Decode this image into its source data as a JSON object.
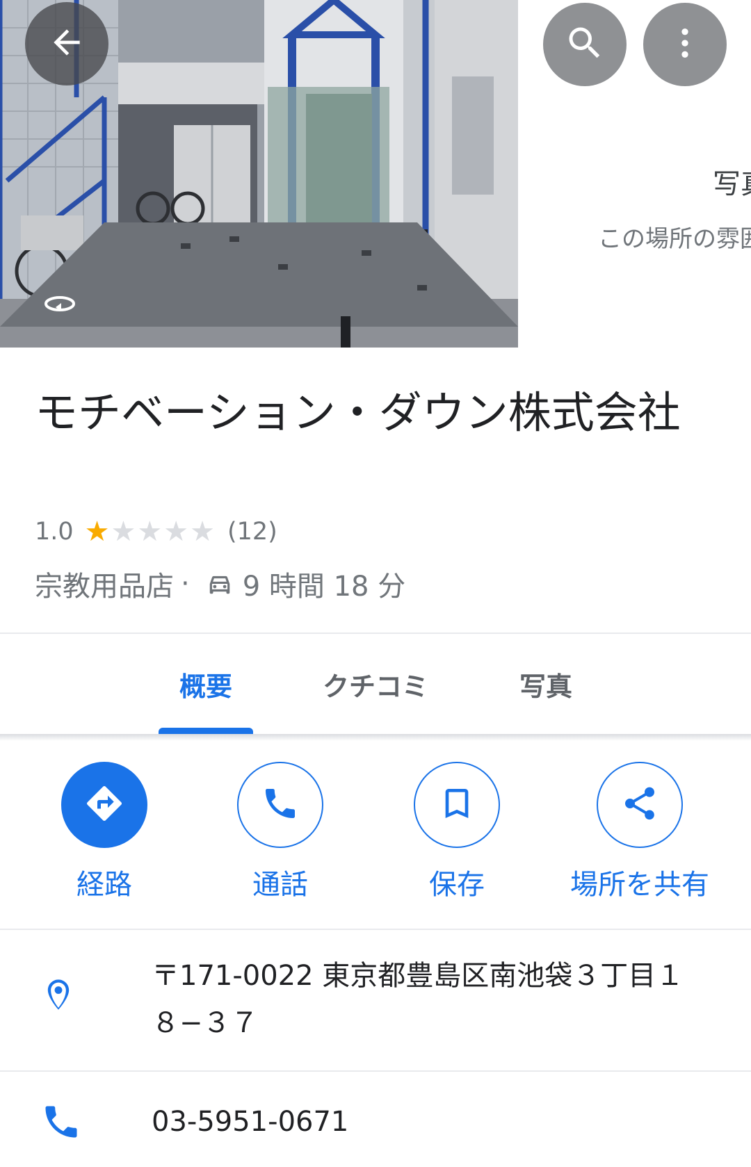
{
  "header": {
    "side_panel_title": "写真",
    "side_panel_subtitle": "この場所の雰囲"
  },
  "place": {
    "name": "モチベーション・ダウン株式会社",
    "rating": "1.0",
    "rating_value": 1.0,
    "rating_max": 5,
    "review_count": "(12)",
    "category": "宗教用品店",
    "separator": "·",
    "drive_time": "9 時間 18 分"
  },
  "tabs": [
    {
      "label": "概要",
      "active": true
    },
    {
      "label": "クチコミ",
      "active": false
    },
    {
      "label": "写真",
      "active": false
    }
  ],
  "actions": [
    {
      "label": "経路",
      "icon": "directions-icon"
    },
    {
      "label": "通話",
      "icon": "phone-icon"
    },
    {
      "label": "保存",
      "icon": "bookmark-icon"
    },
    {
      "label": "場所を共有",
      "icon": "share-icon"
    }
  ],
  "info": {
    "address": "〒171-0022 東京都豊島区南池袋３丁目１８−３７",
    "phone": "03-5951-0671"
  },
  "colors": {
    "accent": "#1a73e8",
    "star": "#f9ab00",
    "muted_text": "#70757a"
  }
}
